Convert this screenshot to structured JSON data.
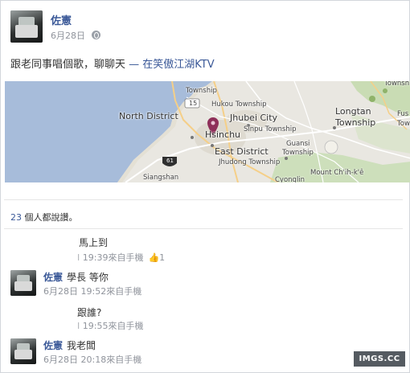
{
  "post": {
    "author": "佐憲",
    "date": "6月28日",
    "status_text": "跟老同事唱個歌，聊聊天",
    "status_separator": " — 在",
    "status_place": "笑傲江湖KTV"
  },
  "map": {
    "labels": {
      "north_district": "North District",
      "hukou_township": "Hukou Township",
      "jhubei_city": "Jhubei City",
      "sinpu_township": "Sinpu Township",
      "longtan_township_1": "Longtan",
      "longtan_township_2": "Township",
      "hsinchu": "Hsinchu",
      "east_district": "East District",
      "jhudong_township": "Jhudong Township",
      "guansi_1": "Guansi",
      "guansi_2": "Township",
      "siangshan": "Siangshan",
      "cyonglin": "Cyonglin",
      "mount": "Mount Ch'ih-k'ê",
      "township_top_left": "Township",
      "township_top_right": "Township",
      "fus_1": "Fus",
      "fus_2": "Tow",
      "route_15": "15",
      "route_61": "61"
    }
  },
  "likes": {
    "count": "23",
    "text": " 個人都說讚。"
  },
  "comments": [
    {
      "name": "",
      "text": "馬上到",
      "time": "19:39",
      "via": "來自手機",
      "like_count": "1"
    },
    {
      "name": "佐憲",
      "text": "學長 等你",
      "date": "6月28日",
      "time": "19:52",
      "via": "來自手機"
    },
    {
      "name": "",
      "text": "跟誰?",
      "time": "19:55",
      "via": "來自手機"
    },
    {
      "name": "佐憲",
      "text": "我老闆",
      "date": "6月28日",
      "time": "20:18",
      "via": "來自手機"
    }
  ],
  "watermark": "IMGS.CC",
  "colors": {
    "link": "#3b5998",
    "meta": "#90949c",
    "sea": "#a7bcda",
    "land": "#e9e7e1",
    "pin": "#8e2f59"
  }
}
